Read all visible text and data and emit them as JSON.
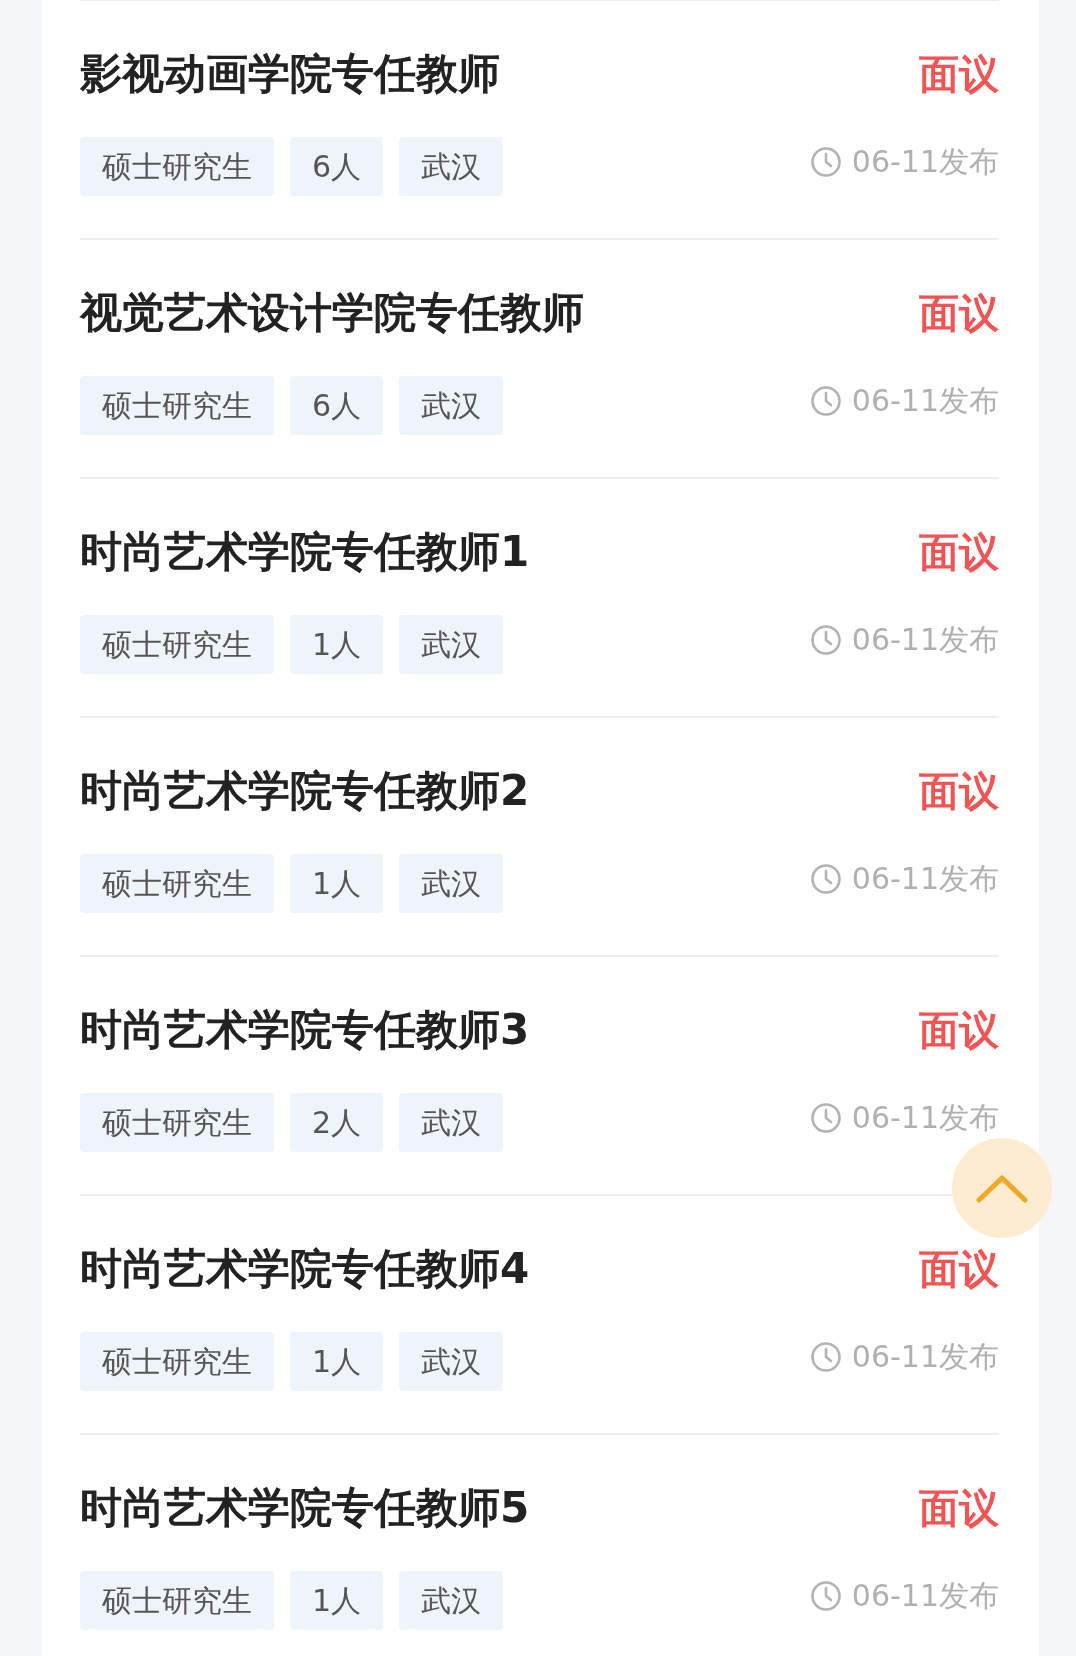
{
  "jobs": [
    {
      "title": "影视动画学院专任教师",
      "salary": "面议",
      "tags": [
        "硕士研究生",
        "6人",
        "武汉"
      ],
      "date": "06-11发布"
    },
    {
      "title": "视觉艺术设计学院专任教师",
      "salary": "面议",
      "tags": [
        "硕士研究生",
        "6人",
        "武汉"
      ],
      "date": "06-11发布"
    },
    {
      "title": "时尚艺术学院专任教师1",
      "salary": "面议",
      "tags": [
        "硕士研究生",
        "1人",
        "武汉"
      ],
      "date": "06-11发布"
    },
    {
      "title": "时尚艺术学院专任教师2",
      "salary": "面议",
      "tags": [
        "硕士研究生",
        "1人",
        "武汉"
      ],
      "date": "06-11发布"
    },
    {
      "title": "时尚艺术学院专任教师3",
      "salary": "面议",
      "tags": [
        "硕士研究生",
        "2人",
        "武汉"
      ],
      "date": "06-11发布"
    },
    {
      "title": "时尚艺术学院专任教师4",
      "salary": "面议",
      "tags": [
        "硕士研究生",
        "1人",
        "武汉"
      ],
      "date": "06-11发布"
    },
    {
      "title": "时尚艺术学院专任教师5",
      "salary": "面议",
      "tags": [
        "硕士研究生",
        "1人",
        "武汉"
      ],
      "date": "06-11发布"
    }
  ]
}
